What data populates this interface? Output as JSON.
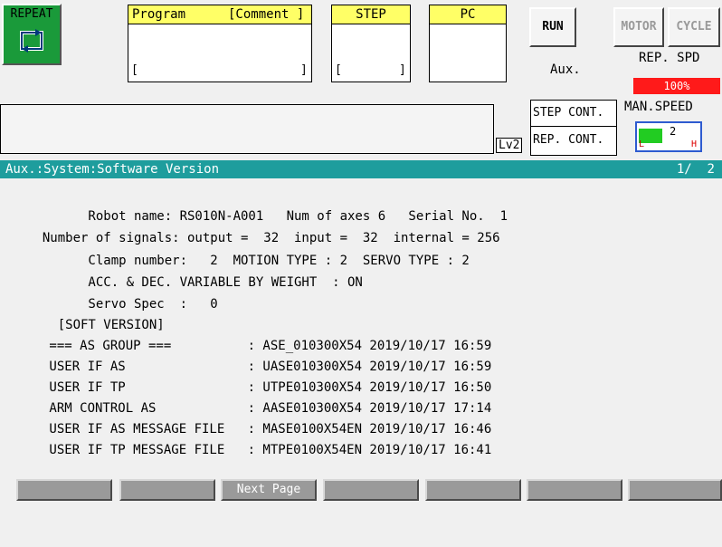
{
  "header": {
    "mode_label": "REPEAT",
    "program_label": "Program",
    "comment_label": "[Comment ]",
    "program_bracket_left": "[",
    "program_bracket_right": "]",
    "step_label": "STEP",
    "step_bracket_left": "[",
    "step_bracket_right": "]",
    "pc_label": "PC",
    "run_label": "RUN",
    "motor_label": "MOTOR",
    "cycle_label": "CYCLE",
    "aux_label": "Aux.",
    "rep_spd_label": "REP. SPD",
    "rep_spd_value": "100%",
    "step_cont_label": "STEP CONT.",
    "rep_cont_label": "REP. CONT.",
    "lv_label": "Lv2",
    "man_speed_label": "MAN.SPEED",
    "man_speed_value": "2",
    "man_speed_low": "L",
    "man_speed_high": "H",
    "man_speed_level": 0.4
  },
  "titlebar": {
    "breadcrumb": "Aux.:System:Software Version",
    "page_indicator": "1/  2"
  },
  "content": {
    "lines": [
      "        Robot name: RS010N-A001   Num of axes 6   Serial No.  1",
      "  Number of signals: output =  32  input =  32  internal = 256",
      "        Clamp number:   2  MOTION TYPE : 2  SERVO TYPE : 2",
      "        ACC. & DEC. VARIABLE BY WEIGHT  : ON",
      "        Servo Spec  :   0",
      "    [SOFT VERSION]",
      " === AS GROUP ===          : ASE_010300X54 2019/10/17 16:59",
      " USER IF AS                : UASE010300X54 2019/10/17 16:59",
      " USER IF TP                : UTPE010300X54 2019/10/17 16:50",
      " ARM CONTROL AS            : AASE010300X54 2019/10/17 17:14",
      " USER IF AS MESSAGE FILE   : MASE0100X54EN 2019/10/17 16:46",
      " USER IF TP MESSAGE FILE   : MTPE0100X54EN 2019/10/17 16:41"
    ]
  },
  "function_keys": [
    "",
    "",
    "Next Page",
    "",
    "",
    "",
    ""
  ],
  "colors": {
    "accent_teal": "#1e9d9d",
    "mode_green": "#1a9a3a",
    "header_yellow": "#ffff66",
    "speed_red": "#ff1a1a"
  }
}
